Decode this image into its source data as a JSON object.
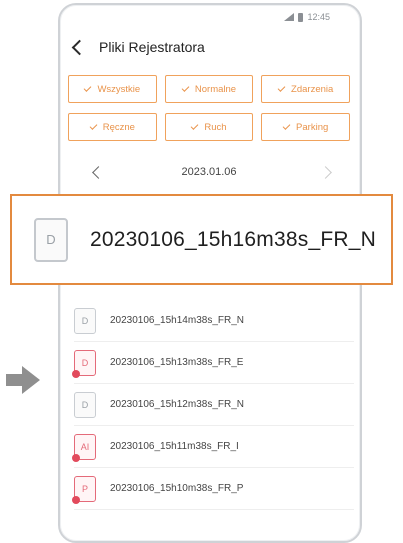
{
  "status_bar": {
    "time": "12:45",
    "signal_icon": "signal-icon",
    "battery_icon": "battery-icon"
  },
  "header": {
    "back_icon": "chevron-left-icon",
    "title": "Pliki Rejestratora"
  },
  "filters": [
    {
      "label": "Wszystkie"
    },
    {
      "label": "Normalne"
    },
    {
      "label": "Zdarzenia"
    },
    {
      "label": "Ręczne"
    },
    {
      "label": "Ruch"
    },
    {
      "label": "Parking"
    }
  ],
  "date_bar": {
    "date": "2023.01.06"
  },
  "highlighted_file": {
    "icon_letter": "D",
    "name": "20230106_15h16m38s_FR_N"
  },
  "files": [
    {
      "icon_letter": "D",
      "name": "20230106_15h14m38s_FR_N",
      "type": "normal"
    },
    {
      "icon_letter": "D",
      "name": "20230106_15h13m38s_FR_E",
      "type": "event"
    },
    {
      "icon_letter": "D",
      "name": "20230106_15h12m38s_FR_N",
      "type": "normal"
    },
    {
      "icon_letter": "AI",
      "name": "20230106_15h11m38s_FR_I",
      "type": "event"
    },
    {
      "icon_letter": "P",
      "name": "20230106_15h10m38s_FR_P",
      "type": "event"
    }
  ],
  "colors": {
    "accent": "#e9934a",
    "event": "#e46a79"
  }
}
